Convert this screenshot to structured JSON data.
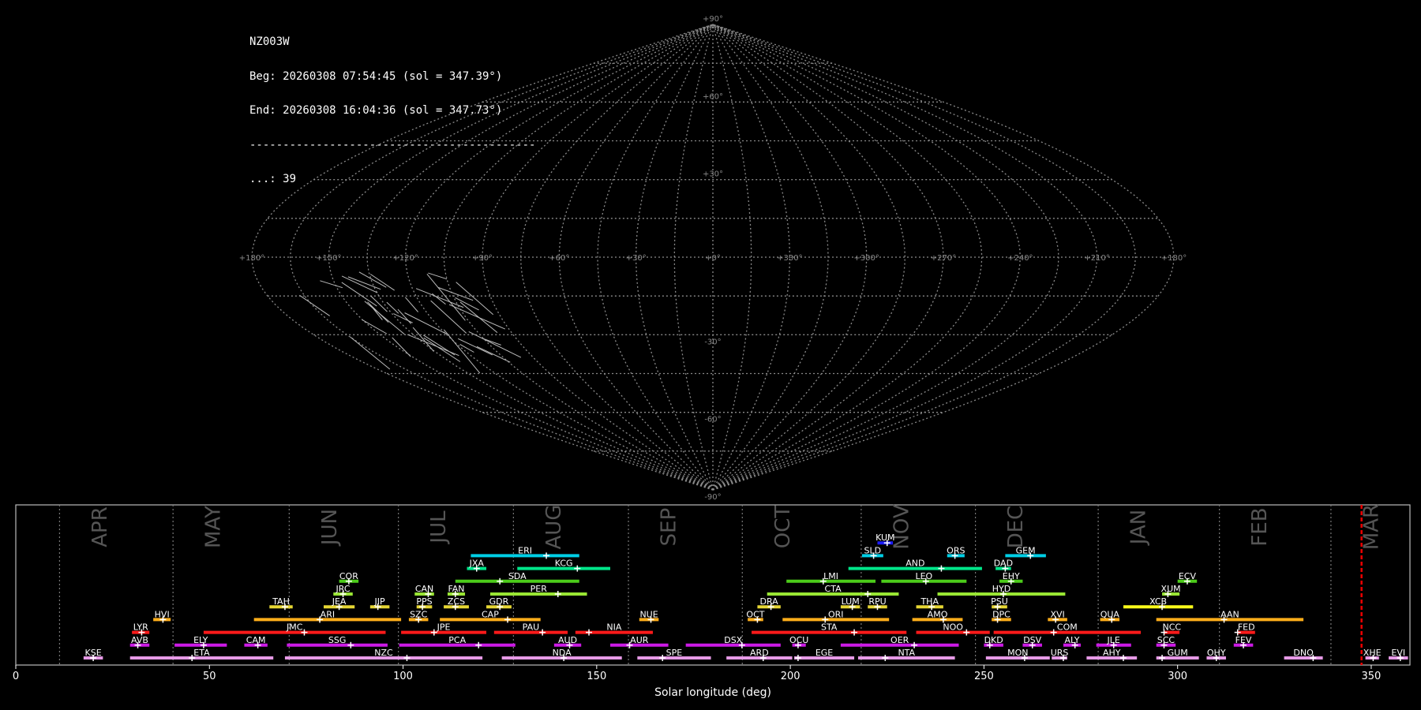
{
  "header": {
    "station": "NZ003W",
    "begin": "Beg: 20260308 07:54:45 (sol = 347.39°)",
    "end": "End: 20260308 16:04:36 (sol = 347.73°)",
    "separator": "-------------------------------------------",
    "count": "...: 39"
  },
  "chart_data": [
    {
      "type": "sky map (sinusoidal projection)",
      "lat_labels": [
        "+90°",
        "+60°",
        "+30°",
        "-30°",
        "-60°",
        "-90°"
      ],
      "lon_labels": [
        "+180°",
        "+150°",
        "+120°",
        "+90°",
        "+60°",
        "+30°",
        "+0°",
        "+330°",
        "+300°",
        "+270°",
        "+240°",
        "+210°",
        "+180°"
      ],
      "lat_grid_step": 15,
      "lon_grid_step": 15,
      "grid": true,
      "meteor_count": 39
    },
    {
      "type": "timeline",
      "xlabel": "Solar longitude (deg)",
      "xlim": [
        0,
        360
      ],
      "x_ticks": [
        0,
        50,
        100,
        150,
        200,
        250,
        300,
        350
      ],
      "months": [
        {
          "label": "APR",
          "start": 11.3,
          "end": 40.6
        },
        {
          "label": "MAY",
          "start": 40.6,
          "end": 70.6
        },
        {
          "label": "JUN",
          "start": 70.6,
          "end": 98.8
        },
        {
          "label": "JUL",
          "start": 98.8,
          "end": 128.5
        },
        {
          "label": "AUG",
          "start": 128.5,
          "end": 158.2
        },
        {
          "label": "SEP",
          "start": 158.2,
          "end": 187.6
        },
        {
          "label": "OCT",
          "start": 187.6,
          "end": 247.8
        },
        {
          "label": "NOV",
          "start": 218.3,
          "end": 247.8
        },
        {
          "label": "DEC",
          "start": 247.8,
          "end": 279.5
        },
        {
          "label": "JAN",
          "start": 279.5,
          "end": 310.8
        },
        {
          "label": "FEB",
          "start": 310.8,
          "end": 339.6
        },
        {
          "label": "MAR",
          "start": 339.6,
          "end": 360
        }
      ],
      "current_sol": 347.5,
      "showers": [
        {
          "code": "KUM",
          "start": 222.5,
          "end": 226.5,
          "peak": 225.0,
          "row": 10,
          "color": "#1a1aff"
        },
        {
          "code": "ERI",
          "start": 117.5,
          "end": 145.5,
          "peak": 137.0,
          "row": 9,
          "color": "#00cfe6"
        },
        {
          "code": "SLD",
          "start": 218.5,
          "end": 224.0,
          "peak": 221.5,
          "row": 9,
          "color": "#00cfe6"
        },
        {
          "code": "ORS",
          "start": 240.5,
          "end": 245.0,
          "peak": 242.5,
          "row": 9,
          "color": "#00cfe6"
        },
        {
          "code": "GEM",
          "start": 255.5,
          "end": 266.0,
          "peak": 262.0,
          "row": 9,
          "color": "#00cfe6"
        },
        {
          "code": "JXA",
          "start": 116.5,
          "end": 121.5,
          "peak": 119.0,
          "row": 8,
          "color": "#00e68a"
        },
        {
          "code": "KCG",
          "start": 129.5,
          "end": 153.5,
          "peak": 145.0,
          "row": 8,
          "color": "#00e68a"
        },
        {
          "code": "AND",
          "start": 215.0,
          "end": 249.5,
          "peak": 239.0,
          "row": 8,
          "color": "#00e68a"
        },
        {
          "code": "DAD",
          "start": 253.0,
          "end": 257.0,
          "peak": 255.5,
          "row": 8,
          "color": "#00e68a"
        },
        {
          "code": "COR",
          "start": 83.5,
          "end": 88.5,
          "peak": 86.0,
          "row": 7,
          "color": "#4ccc1a"
        },
        {
          "code": "SDA",
          "start": 113.5,
          "end": 145.5,
          "peak": 125.0,
          "row": 7,
          "color": "#4ccc1a"
        },
        {
          "code": "LMI",
          "start": 199.0,
          "end": 222.0,
          "peak": 208.5,
          "row": 7,
          "color": "#4ccc1a"
        },
        {
          "code": "LEO",
          "start": 223.5,
          "end": 245.5,
          "peak": 235.0,
          "row": 7,
          "color": "#4ccc1a"
        },
        {
          "code": "EHY",
          "start": 254.0,
          "end": 260.0,
          "peak": 257.0,
          "row": 7,
          "color": "#4ccc1a"
        },
        {
          "code": "ECV",
          "start": 300.0,
          "end": 305.0,
          "peak": 302.5,
          "row": 7,
          "color": "#4ccc1a"
        },
        {
          "code": "JRC",
          "start": 82.0,
          "end": 87.0,
          "peak": 84.5,
          "row": 6,
          "color": "#99e633"
        },
        {
          "code": "CAN",
          "start": 103.0,
          "end": 108.0,
          "peak": 106.5,
          "row": 6,
          "color": "#99e633"
        },
        {
          "code": "FAN",
          "start": 111.5,
          "end": 116.0,
          "peak": 113.5,
          "row": 6,
          "color": "#99e633"
        },
        {
          "code": "PER",
          "start": 122.5,
          "end": 147.5,
          "peak": 140.0,
          "row": 6,
          "color": "#99e633"
        },
        {
          "code": "CTA",
          "start": 194.0,
          "end": 228.0,
          "peak": 220.0,
          "row": 6,
          "color": "#99e633"
        },
        {
          "code": "HYD",
          "start": 238.0,
          "end": 271.0,
          "peak": 255.0,
          "row": 6,
          "color": "#99e633"
        },
        {
          "code": "XUM",
          "start": 296.0,
          "end": 300.5,
          "peak": 297.5,
          "row": 6,
          "color": "#99e633"
        },
        {
          "code": "TAH",
          "start": 65.5,
          "end": 71.5,
          "peak": 69.5,
          "row": 5,
          "color": "#e6d633"
        },
        {
          "code": "JEA",
          "start": 79.5,
          "end": 87.5,
          "peak": 83.5,
          "row": 5,
          "color": "#e6d633"
        },
        {
          "code": "JIP",
          "start": 91.5,
          "end": 96.5,
          "peak": 93.5,
          "row": 5,
          "color": "#e6d633"
        },
        {
          "code": "PPS",
          "start": 103.5,
          "end": 107.5,
          "peak": 105.0,
          "row": 5,
          "color": "#e6d633"
        },
        {
          "code": "ZCS",
          "start": 110.5,
          "end": 117.0,
          "peak": 113.5,
          "row": 5,
          "color": "#e6d633"
        },
        {
          "code": "GDR",
          "start": 121.5,
          "end": 128.0,
          "peak": 125.0,
          "row": 5,
          "color": "#e6d633"
        },
        {
          "code": "DRA",
          "start": 191.5,
          "end": 197.5,
          "peak": 195.0,
          "row": 5,
          "color": "#e6d633"
        },
        {
          "code": "LUM",
          "start": 213.0,
          "end": 218.0,
          "peak": 216.0,
          "row": 5,
          "color": "#e6d633"
        },
        {
          "code": "RPU",
          "start": 220.0,
          "end": 225.0,
          "peak": 222.5,
          "row": 5,
          "color": "#e6d633"
        },
        {
          "code": "THA",
          "start": 232.5,
          "end": 239.5,
          "peak": 236.5,
          "row": 5,
          "color": "#e6d633"
        },
        {
          "code": "PSU",
          "start": 252.0,
          "end": 256.0,
          "peak": 253.5,
          "row": 5,
          "color": "#e6d633"
        },
        {
          "code": "XCB",
          "start": 286.0,
          "end": 304.0,
          "peak": 296.0,
          "row": 5,
          "color": "#ffff1a"
        },
        {
          "code": "HVI",
          "start": 35.5,
          "end": 40.0,
          "peak": 38.0,
          "row": 4,
          "color": "#ffae1a"
        },
        {
          "code": "ARI",
          "start": 61.5,
          "end": 99.5,
          "peak": 78.5,
          "row": 4,
          "color": "#ffae1a"
        },
        {
          "code": "SZC",
          "start": 101.5,
          "end": 106.5,
          "peak": 104.0,
          "row": 4,
          "color": "#ffae1a"
        },
        {
          "code": "CAP",
          "start": 109.5,
          "end": 135.5,
          "peak": 127.0,
          "row": 4,
          "color": "#ffae1a"
        },
        {
          "code": "NUE",
          "start": 161.0,
          "end": 166.0,
          "peak": 164.0,
          "row": 4,
          "color": "#ffae1a"
        },
        {
          "code": "OCT",
          "start": 189.0,
          "end": 193.0,
          "peak": 191.5,
          "row": 4,
          "color": "#ffae1a"
        },
        {
          "code": "ORI",
          "start": 198.0,
          "end": 225.5,
          "peak": 209.0,
          "row": 4,
          "color": "#ffae1a"
        },
        {
          "code": "AMO",
          "start": 231.5,
          "end": 244.5,
          "peak": 239.5,
          "row": 4,
          "color": "#ffae1a"
        },
        {
          "code": "DPC",
          "start": 252.0,
          "end": 257.0,
          "peak": 253.5,
          "row": 4,
          "color": "#ffae1a"
        },
        {
          "code": "XVI",
          "start": 266.5,
          "end": 271.5,
          "peak": 268.5,
          "row": 4,
          "color": "#ffae1a"
        },
        {
          "code": "QUA",
          "start": 280.0,
          "end": 285.0,
          "peak": 283.0,
          "row": 4,
          "color": "#ffae1a"
        },
        {
          "code": "AAN",
          "start": 294.5,
          "end": 332.5,
          "peak": 312.0,
          "row": 4,
          "color": "#ffae1a"
        },
        {
          "code": "LYR",
          "start": 30.0,
          "end": 34.5,
          "peak": 32.5,
          "row": 3,
          "color": "#ff1a1a"
        },
        {
          "code": "JMC",
          "start": 48.5,
          "end": 95.5,
          "peak": 74.5,
          "row": 3,
          "color": "#ff1a1a"
        },
        {
          "code": "JPE",
          "start": 99.5,
          "end": 121.5,
          "peak": 108.0,
          "row": 3,
          "color": "#ff1a1a"
        },
        {
          "code": "PAU",
          "start": 123.5,
          "end": 142.5,
          "peak": 136.0,
          "row": 3,
          "color": "#ff1a1a"
        },
        {
          "code": "NIA",
          "start": 144.5,
          "end": 164.5,
          "peak": 148.0,
          "row": 3,
          "color": "#ff1a1a"
        },
        {
          "code": "STA",
          "start": 190.0,
          "end": 230.0,
          "peak": 216.5,
          "row": 3,
          "color": "#ff1a1a"
        },
        {
          "code": "NOO",
          "start": 232.5,
          "end": 251.5,
          "peak": 245.5,
          "row": 3,
          "color": "#ff1a1a"
        },
        {
          "code": "COM",
          "start": 252.5,
          "end": 290.5,
          "peak": 268.0,
          "row": 3,
          "color": "#ff1a1a"
        },
        {
          "code": "NCC",
          "start": 296.5,
          "end": 300.5,
          "peak": 296.5,
          "row": 3,
          "color": "#ff1a1a"
        },
        {
          "code": "FED",
          "start": 315.5,
          "end": 320.0,
          "peak": 315.5,
          "row": 3,
          "color": "#ff1a1a"
        },
        {
          "code": "AVB",
          "start": 29.5,
          "end": 34.5,
          "peak": 31.5,
          "row": 2,
          "color": "#cc1ae6"
        },
        {
          "code": "ELY",
          "start": 41.0,
          "end": 54.5,
          "peak": 48.5,
          "row": 2,
          "color": "#cc1ae6"
        },
        {
          "code": "CAM",
          "start": 59.0,
          "end": 65.0,
          "peak": 62.5,
          "row": 2,
          "color": "#cc1ae6"
        },
        {
          "code": "SSG",
          "start": 70.0,
          "end": 96.0,
          "peak": 86.5,
          "row": 2,
          "color": "#cc1ae6"
        },
        {
          "code": "PCA",
          "start": 99.0,
          "end": 129.0,
          "peak": 119.5,
          "row": 2,
          "color": "#cc1ae6"
        },
        {
          "code": "AUD",
          "start": 139.0,
          "end": 146.0,
          "peak": 143.0,
          "row": 2,
          "color": "#cc1ae6"
        },
        {
          "code": "AUR",
          "start": 153.5,
          "end": 168.5,
          "peak": 158.5,
          "row": 2,
          "color": "#cc1ae6"
        },
        {
          "code": "DSX",
          "start": 173.0,
          "end": 197.5,
          "peak": 187.5,
          "row": 2,
          "color": "#cc1ae6"
        },
        {
          "code": "OCU",
          "start": 200.5,
          "end": 204.0,
          "peak": 202.0,
          "row": 2,
          "color": "#cc1ae6"
        },
        {
          "code": "OER",
          "start": 213.0,
          "end": 243.5,
          "peak": 232.0,
          "row": 2,
          "color": "#cc1ae6"
        },
        {
          "code": "DKD",
          "start": 250.0,
          "end": 255.0,
          "peak": 251.5,
          "row": 2,
          "color": "#cc1ae6"
        },
        {
          "code": "DSV",
          "start": 260.0,
          "end": 265.0,
          "peak": 262.5,
          "row": 2,
          "color": "#cc1ae6"
        },
        {
          "code": "ALY",
          "start": 270.5,
          "end": 275.0,
          "peak": 273.5,
          "row": 2,
          "color": "#cc1ae6"
        },
        {
          "code": "JLE",
          "start": 279.0,
          "end": 288.0,
          "peak": 283.5,
          "row": 2,
          "color": "#cc1ae6"
        },
        {
          "code": "SCC",
          "start": 294.5,
          "end": 299.5,
          "peak": 296.5,
          "row": 2,
          "color": "#cc1ae6"
        },
        {
          "code": "FEV",
          "start": 314.5,
          "end": 319.5,
          "peak": 317.0,
          "row": 2,
          "color": "#cc1ae6"
        },
        {
          "code": "KSE",
          "start": 17.5,
          "end": 22.5,
          "peak": 20.0,
          "row": 1,
          "color": "#e699e6"
        },
        {
          "code": "ETA",
          "start": 29.5,
          "end": 66.5,
          "peak": 45.5,
          "row": 1,
          "color": "#e699e6"
        },
        {
          "code": "NZC",
          "start": 69.5,
          "end": 120.5,
          "peak": 101.0,
          "row": 1,
          "color": "#e699e6"
        },
        {
          "code": "NDA",
          "start": 125.5,
          "end": 156.5,
          "peak": 141.5,
          "row": 1,
          "color": "#e699e6"
        },
        {
          "code": "SPE",
          "start": 160.5,
          "end": 179.5,
          "peak": 167.0,
          "row": 1,
          "color": "#e699e6"
        },
        {
          "code": "ARD",
          "start": 183.5,
          "end": 200.5,
          "peak": 193.0,
          "row": 1,
          "color": "#e699e6"
        },
        {
          "code": "EGE",
          "start": 201.0,
          "end": 216.5,
          "peak": 202.0,
          "row": 1,
          "color": "#e699e6"
        },
        {
          "code": "NTA",
          "start": 217.5,
          "end": 242.5,
          "peak": 224.5,
          "row": 1,
          "color": "#e699e6"
        },
        {
          "code": "MON",
          "start": 250.5,
          "end": 267.0,
          "peak": 260.5,
          "row": 1,
          "color": "#e699e6"
        },
        {
          "code": "URS",
          "start": 267.5,
          "end": 271.5,
          "peak": 270.5,
          "row": 1,
          "color": "#e699e6"
        },
        {
          "code": "AHY",
          "start": 276.5,
          "end": 289.5,
          "peak": 286.0,
          "row": 1,
          "color": "#e699e6"
        },
        {
          "code": "GUM",
          "start": 294.5,
          "end": 305.5,
          "peak": 296.0,
          "row": 1,
          "color": "#e699e6"
        },
        {
          "code": "OHY",
          "start": 307.5,
          "end": 312.5,
          "peak": 310.0,
          "row": 1,
          "color": "#e699e6"
        },
        {
          "code": "DNO",
          "start": 327.5,
          "end": 337.5,
          "peak": 335.0,
          "row": 1,
          "color": "#e699e6"
        },
        {
          "code": "XHE",
          "start": 348.5,
          "end": 352.0,
          "peak": 350.5,
          "row": 1,
          "color": "#e699e6"
        },
        {
          "code": "EVI",
          "start": 354.5,
          "end": 359.5,
          "peak": 357.5,
          "row": 1,
          "color": "#e699e6"
        }
      ]
    }
  ]
}
